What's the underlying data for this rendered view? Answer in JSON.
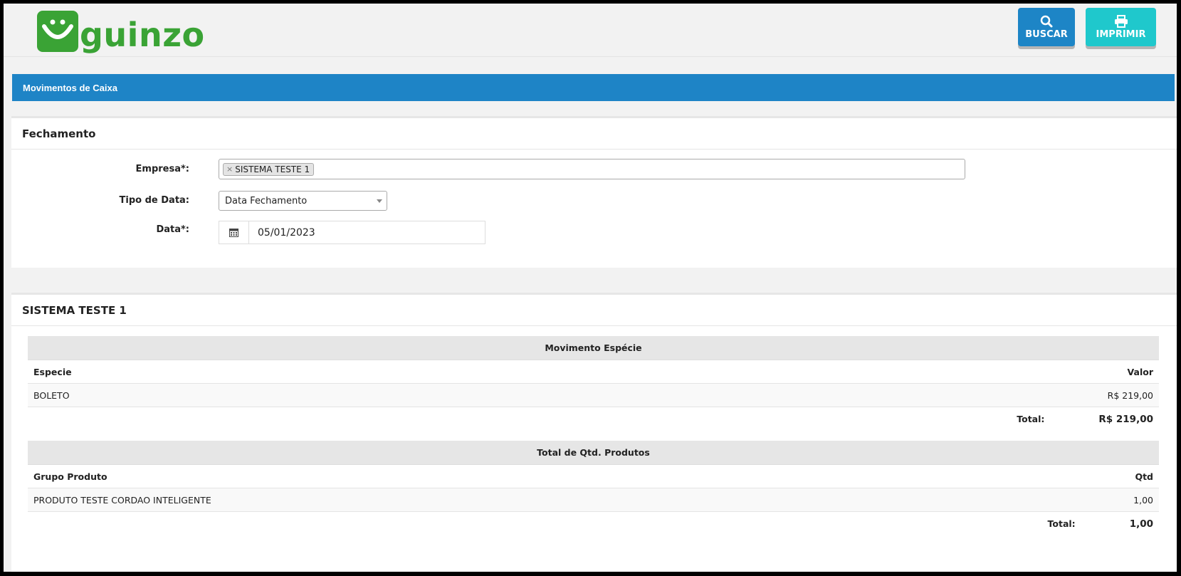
{
  "header": {
    "logo_text": "guinzo",
    "buscar_label": "BUSCAR",
    "imprimir_label": "IMPRIMIR"
  },
  "titlebar": {
    "title": "Movimentos de Caixa"
  },
  "fechamento": {
    "heading": "Fechamento",
    "empresa_label": "Empresa*:",
    "empresa_tag": "SISTEMA TESTE 1",
    "tipo_data_label": "Tipo de Data:",
    "tipo_data_value": "Data Fechamento",
    "data_label": "Data*:",
    "data_value": "05/01/2023"
  },
  "report": {
    "heading": "SISTEMA TESTE 1",
    "especie_table": {
      "title": "Movimento Espécie",
      "col_left": "Especie",
      "col_right": "Valor",
      "rows": [
        {
          "name": "BOLETO",
          "value": "R$ 219,00"
        }
      ],
      "total_label": "Total:",
      "total_value": "R$ 219,00"
    },
    "produtos_table": {
      "title": "Total de Qtd. Produtos",
      "col_left": "Grupo Produto",
      "col_right": "Qtd",
      "rows": [
        {
          "name": "PRODUTO TESTE CORDAO INTELIGENTE",
          "value": "1,00"
        }
      ],
      "total_label": "Total:",
      "total_value": "1,00"
    }
  },
  "colors": {
    "brand_green": "#3aa335",
    "primary_blue": "#1e84c6",
    "teal": "#1fc8cc"
  }
}
